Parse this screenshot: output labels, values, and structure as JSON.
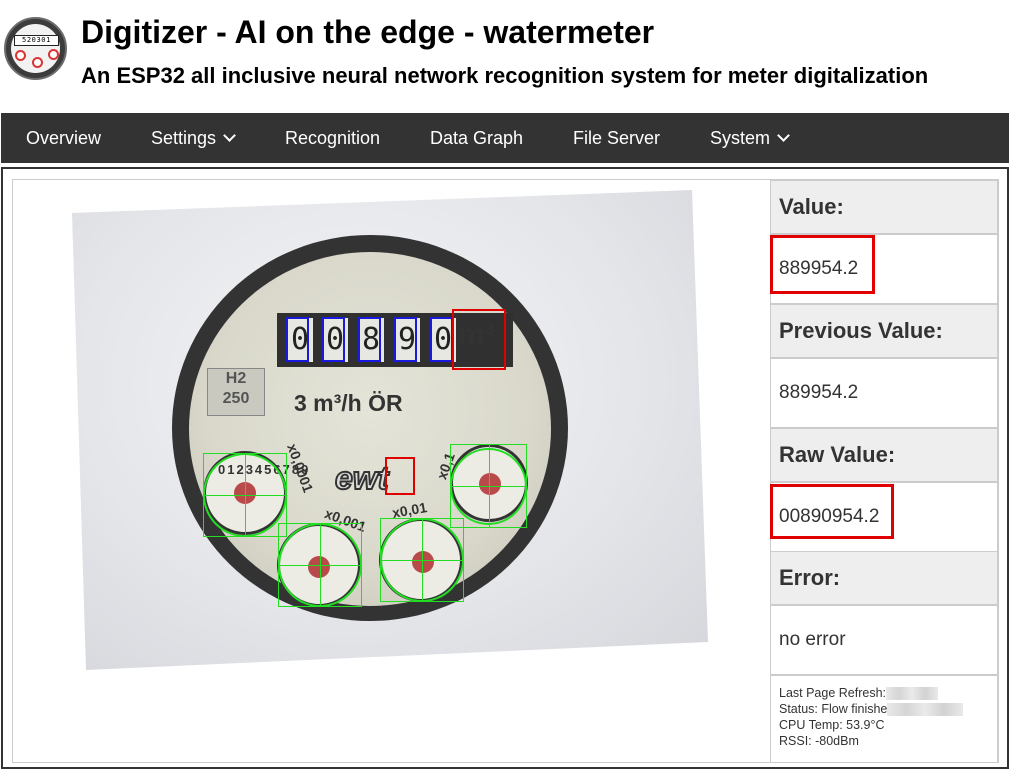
{
  "header": {
    "title": "Digitizer - AI on the edge - watermeter",
    "subtitle": "An ESP32 all inclusive neural network recognition system for meter digitalization",
    "logo_digits": "520301"
  },
  "nav": {
    "items": [
      {
        "label": "Overview",
        "has_dropdown": false
      },
      {
        "label": "Settings",
        "has_dropdown": true
      },
      {
        "label": "Recognition",
        "has_dropdown": false
      },
      {
        "label": "Data Graph",
        "has_dropdown": false
      },
      {
        "label": "File Server",
        "has_dropdown": false
      },
      {
        "label": "System",
        "has_dropdown": true
      }
    ]
  },
  "camera_image": {
    "counter_digits": [
      "0",
      "0",
      "8",
      "9",
      "0"
    ],
    "unit": "m³",
    "flow_text": "3 m³/h ÖR",
    "brand_text": "ewt",
    "plate_text": [
      "H2",
      "250"
    ],
    "dial_multipliers": [
      "x0,0001",
      "x0,001",
      "x0,01",
      "x0,1"
    ],
    "dial_numerals": "0123456789"
  },
  "values": {
    "value_label": "Value:",
    "value": "889954.2",
    "previous_value_label": "Previous Value:",
    "previous_value": "889954.2",
    "raw_value_label": "Raw Value:",
    "raw_value": "00890954.2",
    "error_label": "Error:",
    "error": "no error"
  },
  "status": {
    "last_refresh_label": "Last Page Refresh:",
    "status_label": "Status: Flow finishe",
    "cpu_temp_label": "CPU Temp: 53.9°C",
    "rssi_label": "RSSI: -80dBm"
  },
  "colors": {
    "nav_background": "#333333",
    "cell_header_background": "#eeeeee",
    "highlight": "#e00000",
    "roi_digit": "#1a1adf",
    "roi_analog": "#22dd22"
  }
}
